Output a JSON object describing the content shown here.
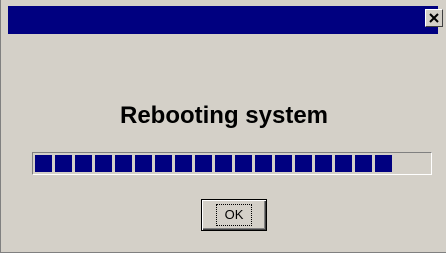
{
  "window": {
    "title": "",
    "close_icon": "close-icon"
  },
  "message": "Rebooting system",
  "progress": {
    "percent": 88,
    "filled_segments": 18,
    "color": "#000080"
  },
  "buttons": {
    "ok_label": "OK"
  },
  "colors": {
    "titlebar": "#000080",
    "face": "#d4d0c8"
  }
}
